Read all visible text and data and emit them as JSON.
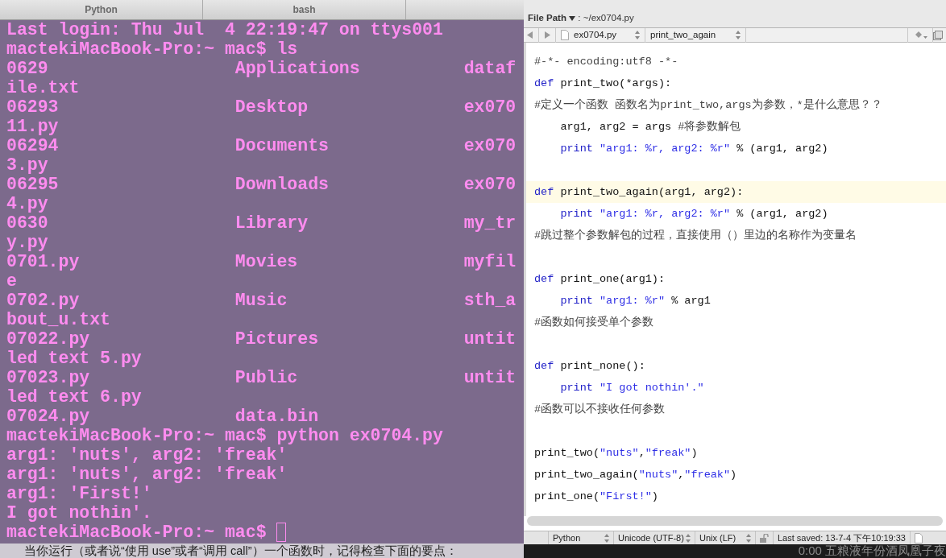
{
  "tabs": [
    {
      "label": "Python"
    },
    {
      "label": "bash"
    }
  ],
  "terminal": {
    "prompt_cursor": true,
    "lines": [
      {
        "kind": "text",
        "text": "Last login: Thu Jul  4 22:19:47 on ttys001"
      },
      {
        "kind": "text",
        "text": "mactekiMacBook-Pro:~ mac$ ls"
      },
      {
        "kind": "columns",
        "cells": [
          "0629",
          "Applications",
          "dataf"
        ]
      },
      {
        "kind": "text",
        "text": "ile.txt"
      },
      {
        "kind": "columns",
        "cells": [
          "06293",
          "Desktop",
          "ex070"
        ]
      },
      {
        "kind": "text",
        "text": "11.py"
      },
      {
        "kind": "columns",
        "cells": [
          "06294",
          "Documents",
          "ex070"
        ]
      },
      {
        "kind": "text",
        "text": "3.py"
      },
      {
        "kind": "columns",
        "cells": [
          "06295",
          "Downloads",
          "ex070"
        ]
      },
      {
        "kind": "text",
        "text": "4.py"
      },
      {
        "kind": "columns",
        "cells": [
          "0630",
          "Library",
          "my_tr"
        ]
      },
      {
        "kind": "text",
        "text": "y.py"
      },
      {
        "kind": "columns",
        "cells": [
          "0701.py",
          "Movies",
          "myfil"
        ]
      },
      {
        "kind": "text",
        "text": "e"
      },
      {
        "kind": "columns",
        "cells": [
          "0702.py",
          "Music",
          "sth_a"
        ]
      },
      {
        "kind": "text",
        "text": "bout_u.txt"
      },
      {
        "kind": "columns",
        "cells": [
          "07022.py",
          "Pictures",
          "untit"
        ]
      },
      {
        "kind": "text",
        "text": "led text 5.py"
      },
      {
        "kind": "columns",
        "cells": [
          "07023.py",
          "Public",
          "untit"
        ]
      },
      {
        "kind": "text",
        "text": "led text 6.py"
      },
      {
        "kind": "columns",
        "cells": [
          "07024.py",
          "data.bin"
        ]
      },
      {
        "kind": "text",
        "text": "mactekiMacBook-Pro:~ mac$ python ex0704.py"
      },
      {
        "kind": "text",
        "text": "arg1: 'nuts', arg2: 'freak'"
      },
      {
        "kind": "text",
        "text": "arg1: 'nuts', arg2: 'freak'"
      },
      {
        "kind": "text",
        "text": "arg1: 'First!'"
      },
      {
        "kind": "text",
        "text": "I got nothin'."
      },
      {
        "kind": "text",
        "text": "mactekiMacBook-Pro:~ mac$ "
      }
    ]
  },
  "page_text": "当你运行（或者说“使用 use”或者“调用 call”）一个函数时，记得检查下面的要点：",
  "editor": {
    "file_path_label": "File Path",
    "file_path_separator": ":",
    "file_path": "~/ex0704.py",
    "file_menu": "ex0704.py",
    "symbol_menu": "print_two_again",
    "lines": [
      {
        "current": false,
        "segments": [
          {
            "kind": "comment",
            "text": "#-*- encoding:utf8 -*-"
          }
        ]
      },
      {
        "current": false,
        "segments": [
          {
            "kind": "keyword",
            "text": "def"
          },
          {
            "kind": "plain",
            "text": " print_two(*args):"
          }
        ]
      },
      {
        "current": false,
        "segments": [
          {
            "kind": "comment",
            "text": "#定义一个函数 函数名为print_two,args为参数，*是什么意思？？"
          }
        ]
      },
      {
        "current": false,
        "segments": [
          {
            "kind": "plain",
            "text": "    arg1, arg2 = args "
          },
          {
            "kind": "comment",
            "text": "#将参数解包"
          }
        ]
      },
      {
        "current": false,
        "segments": [
          {
            "kind": "keyword",
            "text": "    print "
          },
          {
            "kind": "string",
            "text": "\"arg1: %r, arg2: %r\""
          },
          {
            "kind": "plain",
            "text": " % (arg1, arg2)"
          }
        ]
      },
      {
        "current": false
      },
      {
        "current": true,
        "segments": [
          {
            "kind": "keyword",
            "text": "def"
          },
          {
            "kind": "plain",
            "text": " print_two_again(arg1, arg2):"
          }
        ]
      },
      {
        "current": false,
        "segments": [
          {
            "kind": "keyword",
            "text": "    print "
          },
          {
            "kind": "string",
            "text": "\"arg1: %r, arg2: %r\""
          },
          {
            "kind": "plain",
            "text": " % (arg1, arg2)"
          }
        ]
      },
      {
        "current": false,
        "segments": [
          {
            "kind": "comment",
            "text": "#跳过整个参数解包的过程，直接使用（）里边的名称作为变量名"
          }
        ]
      },
      {
        "current": false
      },
      {
        "current": false,
        "segments": [
          {
            "kind": "keyword",
            "text": "def"
          },
          {
            "kind": "plain",
            "text": " print_one(arg1):"
          }
        ]
      },
      {
        "current": false,
        "segments": [
          {
            "kind": "keyword",
            "text": "    print "
          },
          {
            "kind": "string",
            "text": "\"arg1: %r\""
          },
          {
            "kind": "plain",
            "text": " % arg1"
          }
        ]
      },
      {
        "current": false,
        "segments": [
          {
            "kind": "comment",
            "text": "#函数如何接受单个参数"
          }
        ]
      },
      {
        "current": false
      },
      {
        "current": false,
        "segments": [
          {
            "kind": "keyword",
            "text": "def"
          },
          {
            "kind": "plain",
            "text": " print_none():"
          }
        ]
      },
      {
        "current": false,
        "segments": [
          {
            "kind": "keyword",
            "text": "    print "
          },
          {
            "kind": "string",
            "text": "\"I got nothin'.\""
          }
        ]
      },
      {
        "current": false,
        "segments": [
          {
            "kind": "comment",
            "text": "#函数可以不接收任何参数"
          }
        ]
      },
      {
        "current": false
      },
      {
        "current": false,
        "segments": [
          {
            "kind": "plain",
            "text": "print_two("
          },
          {
            "kind": "string",
            "text": "\"nuts\""
          },
          {
            "kind": "plain",
            "text": ","
          },
          {
            "kind": "string",
            "text": "\"freak\""
          },
          {
            "kind": "plain",
            "text": ")"
          }
        ]
      },
      {
        "current": false,
        "segments": [
          {
            "kind": "plain",
            "text": "print_two_again("
          },
          {
            "kind": "string",
            "text": "\"nuts\""
          },
          {
            "kind": "plain",
            "text": ","
          },
          {
            "kind": "string",
            "text": "\"freak\""
          },
          {
            "kind": "plain",
            "text": ")"
          }
        ]
      },
      {
        "current": false,
        "segments": [
          {
            "kind": "plain",
            "text": "print_one("
          },
          {
            "kind": "string",
            "text": "\"First!\""
          },
          {
            "kind": "plain",
            "text": ")"
          }
        ]
      }
    ],
    "status": {
      "language": "Python",
      "encoding": "Unicode (UTF-8)",
      "line_endings": "Unix (LF)",
      "last_saved": "Last saved: 13-7-4 下午10:19:33"
    }
  },
  "video_strip": {
    "text": "0:00 五粮液年份酒凤凰子夜"
  }
}
